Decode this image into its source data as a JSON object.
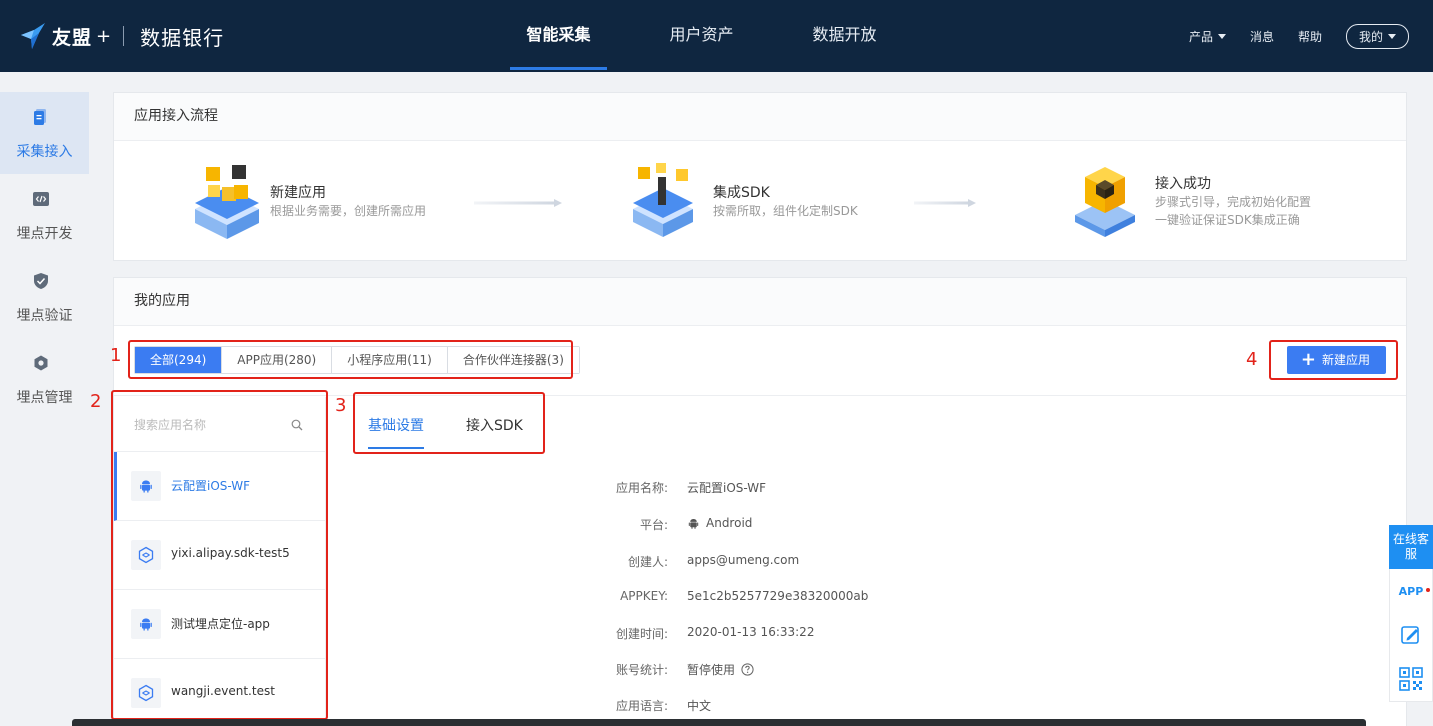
{
  "brand": {
    "logo_text": "友盟",
    "logo_plus": "+",
    "product": "数据银行"
  },
  "main_nav": [
    {
      "label": "智能采集",
      "active": true
    },
    {
      "label": "用户资产",
      "active": false
    },
    {
      "label": "数据开放",
      "active": false
    }
  ],
  "right_nav": {
    "product": "产品",
    "messages": "消息",
    "help": "帮助",
    "mine": "我的"
  },
  "sidebar": [
    {
      "label": "采集接入",
      "icon": "document-icon",
      "active": true
    },
    {
      "label": "埋点开发",
      "icon": "code-icon",
      "active": false
    },
    {
      "label": "埋点验证",
      "icon": "shield-check-icon",
      "active": false
    },
    {
      "label": "埋点管理",
      "icon": "hexagon-gear-icon",
      "active": false
    }
  ],
  "flow": {
    "title": "应用接入流程",
    "steps": [
      {
        "title": "新建应用",
        "desc": [
          "根据业务需要，创建所需应用"
        ]
      },
      {
        "title": "集成SDK",
        "desc": [
          "按需所取，组件化定制SDK"
        ]
      },
      {
        "title": "接入成功",
        "desc": [
          "步骤式引导，完成初始化配置",
          "一键验证保证SDK集成正确"
        ]
      }
    ]
  },
  "my_apps": {
    "title": "我的应用",
    "filters": [
      {
        "label": "全部(294)",
        "active": true
      },
      {
        "label": "APP应用(280)",
        "active": false
      },
      {
        "label": "小程序应用(11)",
        "active": false
      },
      {
        "label": "合作伙伴连接器(3)",
        "active": false
      }
    ],
    "new_button": "新建应用",
    "search_placeholder": "搜索应用名称",
    "apps": [
      {
        "name": "云配置iOS-WF",
        "icon": "android-icon",
        "active": true
      },
      {
        "name": "yixi.alipay.sdk-test5",
        "icon": "miniapp-icon",
        "active": false
      },
      {
        "name": "测试埋点定位-app",
        "icon": "android-icon",
        "active": false
      },
      {
        "name": "wangji.event.test",
        "icon": "miniapp-icon",
        "active": false
      }
    ],
    "tabs": [
      {
        "label": "基础设置",
        "active": true
      },
      {
        "label": "接入SDK",
        "active": false
      }
    ],
    "details": [
      {
        "label": "应用名称:",
        "value": "云配置iOS-WF"
      },
      {
        "label": "平台:",
        "value": "Android",
        "icon": "android-icon"
      },
      {
        "label": "创建人:",
        "value": "apps@umeng.com"
      },
      {
        "label": "APPKEY:",
        "value": "5e1c2b5257729e38320000ab"
      },
      {
        "label": "创建时间:",
        "value": "2020-01-13 16:33:22"
      },
      {
        "label": "账号统计:",
        "value": "暂停使用",
        "icon": "help-circle-icon"
      },
      {
        "label": "应用语言:",
        "value": "中文"
      }
    ]
  },
  "annotations": [
    "1",
    "2",
    "3",
    "4"
  ],
  "float_service": {
    "chat": "在线客服",
    "app": "APP"
  },
  "colors": {
    "header_bg": "#0f2640",
    "accent": "#3b7cf2",
    "annotation": "#e2231a"
  }
}
